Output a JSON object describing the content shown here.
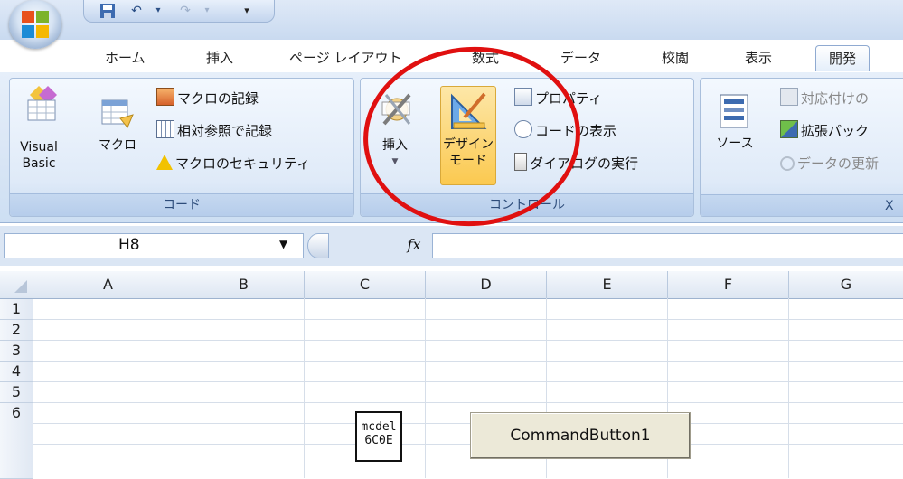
{
  "titlebar": {
    "qat_dropdown": "▾"
  },
  "tabs": [
    {
      "label": "ホーム"
    },
    {
      "label": "挿入"
    },
    {
      "label": "ページ レイアウト"
    },
    {
      "label": "数式"
    },
    {
      "label": "データ"
    },
    {
      "label": "校閲"
    },
    {
      "label": "表示"
    },
    {
      "label": "開発"
    }
  ],
  "ribbon": {
    "code_group": {
      "label": "コード",
      "visual_basic": "Visual\nBasic",
      "visual_basic_line1": "Visual",
      "visual_basic_line2": "Basic",
      "macro": "マクロ",
      "record_macro": "マクロの記録",
      "relative_ref": "相対参照で記録",
      "macro_security": "マクロのセキュリティ"
    },
    "controls_group": {
      "label": "コントロール",
      "insert": "挿入",
      "design_mode_line1": "デザイン",
      "design_mode_line2": "モード",
      "properties": "プロパティ",
      "view_code": "コードの表示",
      "run_dialog": "ダイアログの実行"
    },
    "xml_group": {
      "label": "X",
      "source": "ソース",
      "map_properties": "対応付けの",
      "expansion_packs": "拡張パック",
      "refresh_data": "データの更新"
    }
  },
  "formula_bar": {
    "name_box": "H8",
    "fx": "fx",
    "formula_value": ""
  },
  "grid": {
    "columns": [
      "A",
      "B",
      "C",
      "D",
      "E",
      "F",
      "G"
    ],
    "rows": [
      "1",
      "2",
      "3",
      "4",
      "5",
      "6"
    ]
  },
  "controls": {
    "command_button": "CommandButton1",
    "ime_line1": "mcdel",
    "ime_line2": "6C0E"
  },
  "colors": {
    "annotation_circle": "#e01010",
    "active_button": "#fbd77f",
    "ribbon_bg": "#dfeaf8"
  }
}
